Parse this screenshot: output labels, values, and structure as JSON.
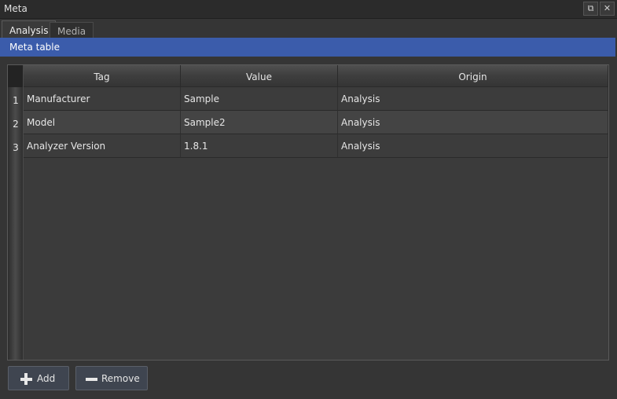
{
  "window": {
    "title": "Meta",
    "float_icon": "float-window-icon",
    "close_icon": "close-icon"
  },
  "tabs": [
    {
      "label": "Analysis",
      "active": true
    },
    {
      "label": "Media",
      "active": false
    }
  ],
  "section": {
    "title": "Meta table",
    "color": "#3b5cab"
  },
  "table": {
    "columns": [
      "Tag",
      "Value",
      "Origin"
    ],
    "rows": [
      {
        "num": "1",
        "tag": "Manufacturer",
        "value": "Sample",
        "origin": "Analysis"
      },
      {
        "num": "2",
        "tag": "Model",
        "value": "Sample2",
        "origin": "Analysis"
      },
      {
        "num": "3",
        "tag": "Analyzer Version",
        "value": "1.8.1",
        "origin": "Analysis"
      }
    ]
  },
  "buttons": {
    "add_label": "Add",
    "add_icon": "plus-icon",
    "remove_label": "Remove",
    "remove_icon": "minus-icon"
  }
}
